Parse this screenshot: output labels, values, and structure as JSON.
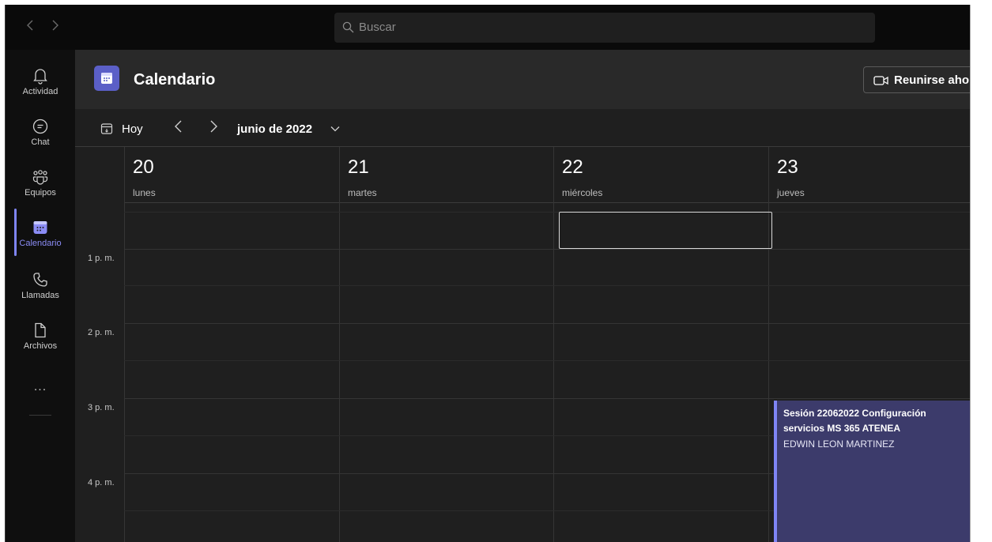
{
  "titlebar": {
    "back": "‹",
    "forward": "›",
    "search_placeholder": "Buscar"
  },
  "rail": {
    "items": [
      {
        "label": "Actividad",
        "icon": "bell-icon"
      },
      {
        "label": "Chat",
        "icon": "chat-icon"
      },
      {
        "label": "Equipos",
        "icon": "teams-icon"
      },
      {
        "label": "Calendario",
        "icon": "calendar-icon",
        "active": true
      },
      {
        "label": "Llamadas",
        "icon": "phone-icon"
      },
      {
        "label": "Archivos",
        "icon": "file-icon"
      }
    ],
    "more": "..."
  },
  "header": {
    "title": "Calendario",
    "meet_now": "Reunirse ahora"
  },
  "toolbar": {
    "today": "Hoy",
    "prev": "<",
    "next": ">",
    "month": "junio de 2022"
  },
  "days": [
    {
      "num": "20",
      "name": "lunes"
    },
    {
      "num": "21",
      "name": "martes"
    },
    {
      "num": "22",
      "name": "miércoles"
    },
    {
      "num": "23",
      "name": "jueves"
    }
  ],
  "times": [
    "1 p. m.",
    "2 p. m.",
    "3 p. m.",
    "4 p. m."
  ],
  "event": {
    "title": "Sesión 22062022 Configuración servicios MS 365 ATENEA",
    "organizer": "EDWIN LEON MARTINEZ"
  },
  "colors": {
    "accent": "#7f85f5",
    "event_bg": "#3c3b6b",
    "calendar_brand": "#5b5fc7"
  }
}
